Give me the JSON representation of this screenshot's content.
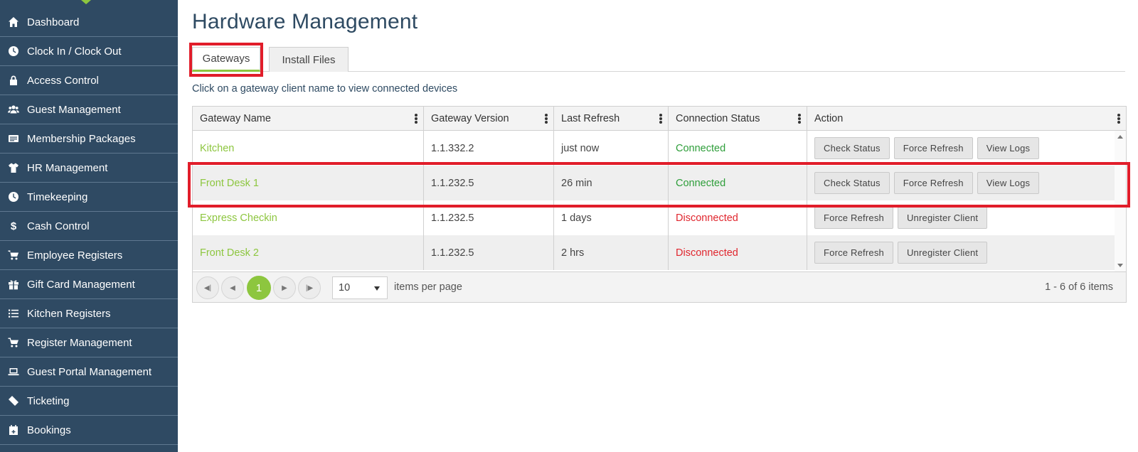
{
  "sidebar": {
    "items": [
      {
        "label": "Dashboard",
        "icon": "home-icon"
      },
      {
        "label": "Clock In / Clock Out",
        "icon": "clock-icon"
      },
      {
        "label": "Access Control",
        "icon": "lock-icon"
      },
      {
        "label": "Guest Management",
        "icon": "users-icon"
      },
      {
        "label": "Membership Packages",
        "icon": "id-card-icon"
      },
      {
        "label": "HR Management",
        "icon": "shirt-icon"
      },
      {
        "label": "Timekeeping",
        "icon": "clock-icon"
      },
      {
        "label": "Cash Control",
        "icon": "dollar-icon"
      },
      {
        "label": "Employee Registers",
        "icon": "cart-icon"
      },
      {
        "label": "Gift Card Management",
        "icon": "gift-icon"
      },
      {
        "label": "Kitchen Registers",
        "icon": "list-icon"
      },
      {
        "label": "Register Management",
        "icon": "cart-icon"
      },
      {
        "label": "Guest Portal Management",
        "icon": "laptop-icon"
      },
      {
        "label": "Ticketing",
        "icon": "ticket-icon"
      },
      {
        "label": "Bookings",
        "icon": "calendar-icon"
      }
    ]
  },
  "page": {
    "title": "Hardware Management",
    "hint": "Click on a gateway client name to view connected devices"
  },
  "tabs": [
    {
      "label": "Gateways",
      "active": true
    },
    {
      "label": "Install Files",
      "active": false
    }
  ],
  "grid": {
    "columns": [
      "Gateway Name",
      "Gateway Version",
      "Last Refresh",
      "Connection Status",
      "Action"
    ],
    "rows": [
      {
        "name": "Kitchen",
        "version": "1.1.332.2",
        "refresh": "just now",
        "status": "Connected",
        "actions": [
          "Check Status",
          "Force Refresh",
          "View Logs"
        ]
      },
      {
        "name": "Front Desk 1",
        "version": "1.1.232.5",
        "refresh": "26 min",
        "status": "Connected",
        "actions": [
          "Check Status",
          "Force Refresh",
          "View Logs"
        ]
      },
      {
        "name": "Express Checkin",
        "version": "1.1.232.5",
        "refresh": "1 days",
        "status": "Disconnected",
        "actions": [
          "Force Refresh",
          "Unregister Client"
        ]
      },
      {
        "name": "Front Desk 2",
        "version": "1.1.232.5",
        "refresh": "2 hrs",
        "status": "Disconnected",
        "actions": [
          "Force Refresh",
          "Unregister Client"
        ]
      }
    ]
  },
  "pager": {
    "current_page": "1",
    "page_size": "10",
    "page_size_label": "items per page",
    "info": "1 - 6 of 6 items"
  },
  "colors": {
    "sidebar_bg": "#2f4a63",
    "accent_green": "#8dc63f",
    "connected": "#2e9e3a",
    "disconnected": "#e0262e",
    "highlight": "#e11d2a"
  }
}
